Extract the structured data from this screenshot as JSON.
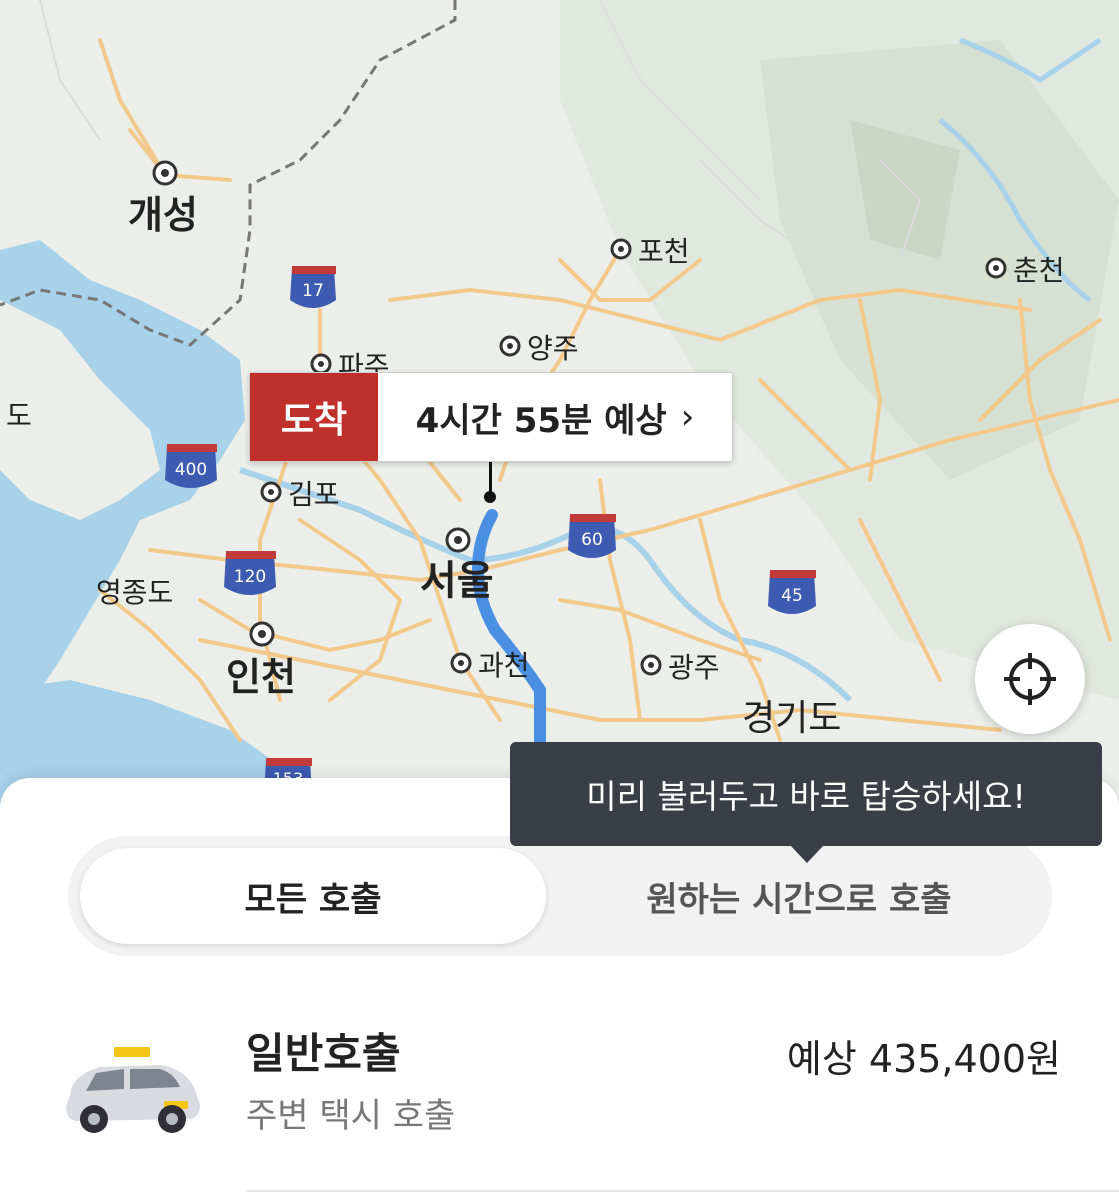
{
  "map": {
    "labels": {
      "kaesong": "개성",
      "pocheon": "포천",
      "chuncheon": "춘천",
      "yangju": "양주",
      "paju": "파주",
      "gimpo": "김포",
      "seoul": "서울",
      "yeongjongdo": "영종도",
      "incheon": "인천",
      "gwacheon": "과천",
      "gwangju": "광주",
      "gyeonggido": "경기도",
      "ganghwado_partial": "도"
    },
    "highway_shields": [
      "17",
      "400",
      "120",
      "60",
      "45",
      "153"
    ],
    "colors": {
      "land": "#eceeea",
      "water": "#a8d1ea",
      "road": "#f3c98b",
      "route": "#4a90e2"
    }
  },
  "eta": {
    "badge": "도착",
    "text": "4시간 55분 예상",
    "chevron": "›"
  },
  "locate_button": {
    "icon": "crosshair-icon"
  },
  "tooltip": {
    "text": "미리 불러두고 바로 탑승하세요!"
  },
  "tabs": {
    "all_calls": "모든 호출",
    "scheduled_call": "원하는 시간으로 호출"
  },
  "ride_option": {
    "title": "일반호출",
    "subtitle": "주변 택시 호출",
    "price": "예상 435,400원",
    "icon": "taxi-icon"
  }
}
